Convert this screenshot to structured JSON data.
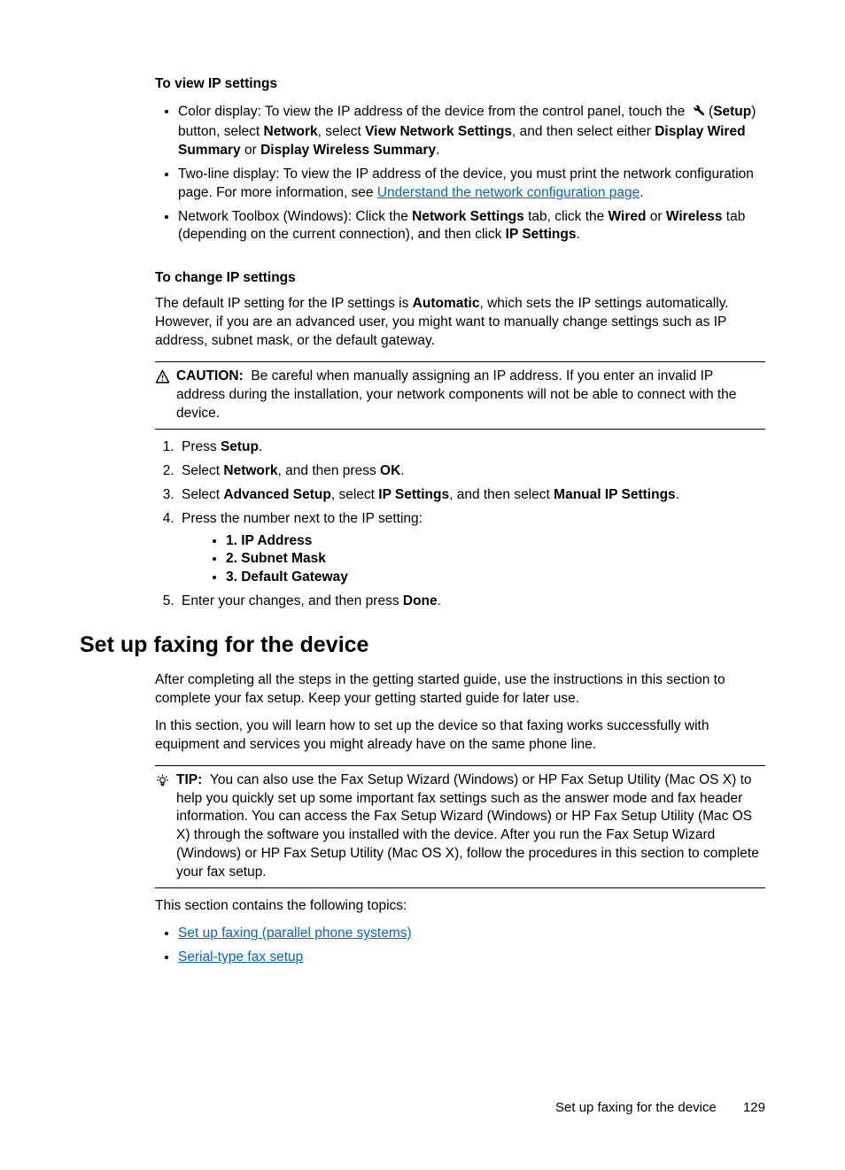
{
  "section1": {
    "heading": "To view IP settings",
    "bullet1_a": "Color display: To view the IP address of the device from the control panel, touch the ",
    "bullet1_b": " (",
    "bullet1_setup": "Setup",
    "bullet1_c": ") button, select ",
    "bullet1_network": "Network",
    "bullet1_d": ", select ",
    "bullet1_vns": "View Network Settings",
    "bullet1_e": ", and then select either ",
    "bullet1_dws": "Display Wired Summary",
    "bullet1_f": " or ",
    "bullet1_dwls": "Display Wireless Summary",
    "bullet1_g": ".",
    "bullet2_a": "Two-line display: To view the IP address of the device, you must print the network configuration page. For more information, see ",
    "bullet2_link": "Understand the network configuration page",
    "bullet2_b": ".",
    "bullet3_a": "Network Toolbox (Windows): Click the ",
    "bullet3_ns": "Network Settings",
    "bullet3_b": " tab, click the ",
    "bullet3_wired": "Wired",
    "bullet3_c": " or ",
    "bullet3_wireless": "Wireless",
    "bullet3_d": " tab (depending on the current connection), and then click ",
    "bullet3_ips": "IP Settings",
    "bullet3_e": "."
  },
  "section2": {
    "heading": "To change IP settings",
    "para_a": "The default IP setting for the IP settings is ",
    "para_auto": "Automatic",
    "para_b": ", which sets the IP settings automatically. However, if you are an advanced user, you might want to manually change settings such as IP address, subnet mask, or the default gateway.",
    "caution_label": "CAUTION:",
    "caution_text": "Be careful when manually assigning an IP address. If you enter an invalid IP address during the installation, your network components will not be able to connect with the device.",
    "step1_a": "Press ",
    "step1_b": "Setup",
    "step1_c": ".",
    "step2_a": "Select ",
    "step2_b": "Network",
    "step2_c": ", and then press ",
    "step2_d": "OK",
    "step2_e": ".",
    "step3_a": "Select ",
    "step3_b": "Advanced Setup",
    "step3_c": ", select ",
    "step3_d": "IP Settings",
    "step3_e": ", and then select ",
    "step3_f": "Manual IP Settings",
    "step3_g": ".",
    "step4": "Press the number next to the IP setting:",
    "ip1": "1. IP Address",
    "ip2": "2. Subnet Mask",
    "ip3": "3. Default Gateway",
    "step5_a": "Enter your changes, and then press ",
    "step5_b": "Done",
    "step5_c": "."
  },
  "section3": {
    "heading": "Set up faxing for the device",
    "para1": "After completing all the steps in the getting started guide, use the instructions in this section to complete your fax setup. Keep your getting started guide for later use.",
    "para2": "In this section, you will learn how to set up the device so that faxing works successfully with equipment and services you might already have on the same phone line.",
    "tip_label": "TIP:",
    "tip_text": "You can also use the Fax Setup Wizard (Windows) or HP Fax Setup Utility (Mac OS X) to help you quickly set up some important fax settings such as the answer mode and fax header information. You can access the Fax Setup Wizard (Windows) or HP Fax Setup Utility (Mac OS X) through the software you installed with the device. After you run the Fax Setup Wizard (Windows) or HP Fax Setup Utility (Mac OS X), follow the procedures in this section to complete your fax setup.",
    "topicsline": "This section contains the following topics:",
    "link1": "Set up faxing (parallel phone systems)",
    "link2": "Serial-type fax setup"
  },
  "footer": {
    "text": "Set up faxing for the device",
    "page": "129"
  }
}
